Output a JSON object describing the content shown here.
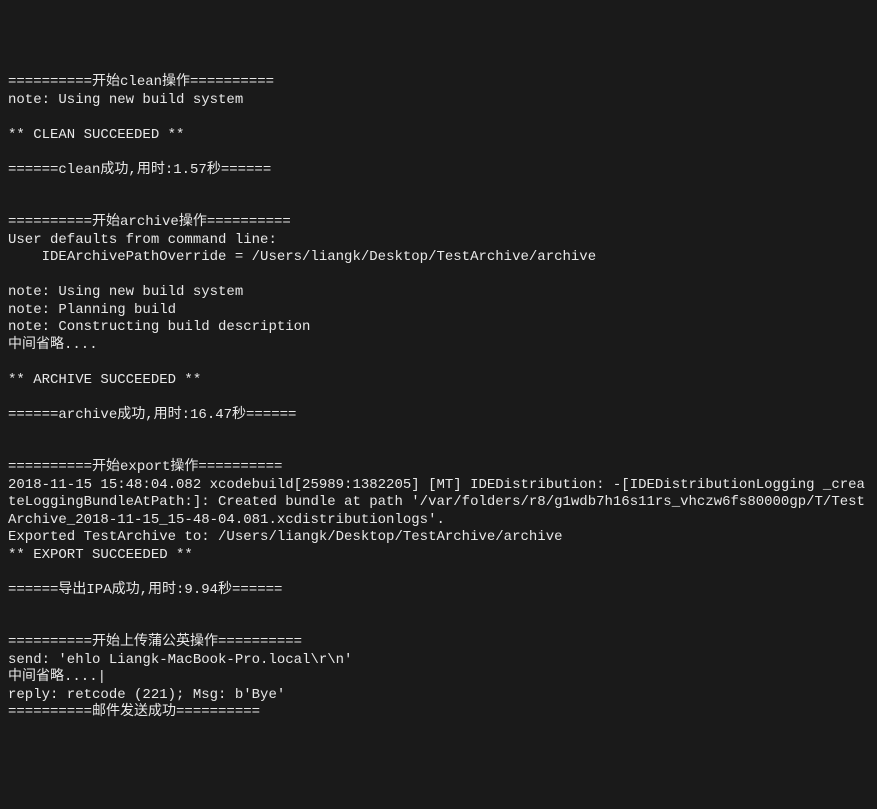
{
  "terminal": {
    "lines": [
      "==========开始clean操作==========",
      "note: Using new build system",
      "",
      "** CLEAN SUCCEEDED **",
      "",
      "======clean成功,用时:1.57秒======",
      "",
      "",
      "==========开始archive操作==========",
      "User defaults from command line:",
      "    IDEArchivePathOverride = /Users/liangk/Desktop/TestArchive/archive",
      "",
      "note: Using new build system",
      "note: Planning build",
      "note: Constructing build description",
      "中间省略....",
      "",
      "** ARCHIVE SUCCEEDED **",
      "",
      "======archive成功,用时:16.47秒======",
      "",
      "",
      "==========开始export操作==========",
      "2018-11-15 15:48:04.082 xcodebuild[25989:1382205] [MT] IDEDistribution: -[IDEDistributionLogging _createLoggingBundleAtPath:]: Created bundle at path '/var/folders/r8/g1wdb7h16s11rs_vhczw6fs80000gp/T/TestArchive_2018-11-15_15-48-04.081.xcdistributionlogs'.",
      "Exported TestArchive to: /Users/liangk/Desktop/TestArchive/archive",
      "** EXPORT SUCCEEDED **",
      "",
      "======导出IPA成功,用时:9.94秒======",
      "",
      "",
      "==========开始上传蒲公英操作==========",
      "send: 'ehlo Liangk-MacBook-Pro.local\\r\\n'",
      "中间省略....|",
      "reply: retcode (221); Msg: b'Bye'",
      "==========邮件发送成功=========="
    ]
  }
}
